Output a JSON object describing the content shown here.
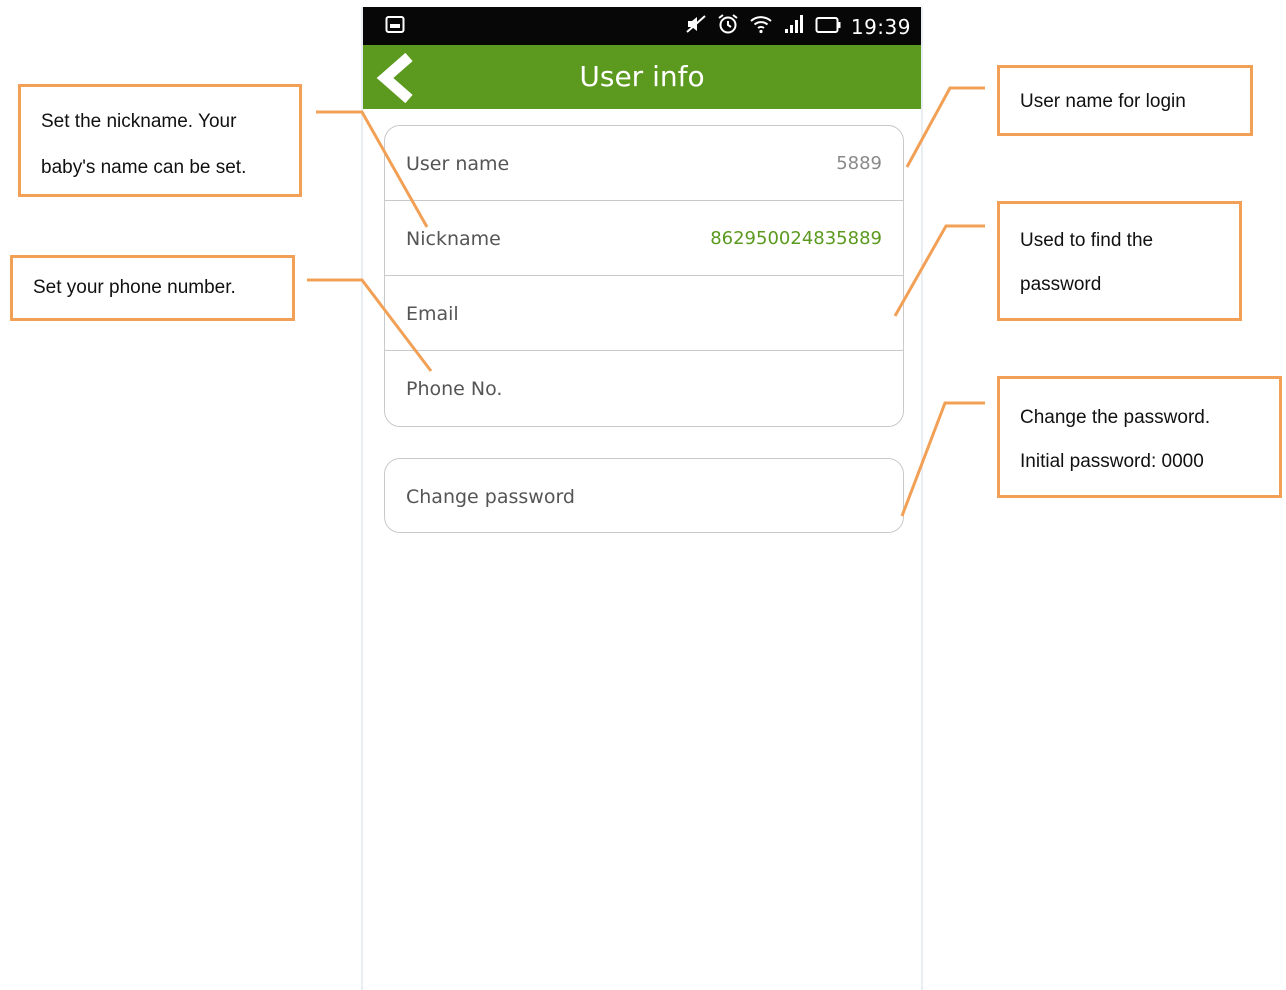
{
  "status_bar": {
    "time": "19:39",
    "left_icon": "image-notification-icon",
    "right_icons": [
      "mute-icon",
      "alarm-icon",
      "wifi-icon",
      "signal-icon",
      "battery-icon"
    ]
  },
  "app_bar": {
    "title": "User info",
    "back_icon": "back-chevron-icon",
    "color": "#5b9a1f"
  },
  "user_fields": [
    {
      "label": "User name",
      "value": "5889"
    },
    {
      "label": "Nickname",
      "value": "862950024835889"
    },
    {
      "label": "Email",
      "value": ""
    },
    {
      "label": "Phone No.",
      "value": ""
    }
  ],
  "change_password": {
    "label": "Change password"
  },
  "annotations": {
    "nickname_note": [
      "Set the nickname. Your",
      "baby's name can be set."
    ],
    "phone_note": [
      "Set your phone number."
    ],
    "username_note": [
      "User name for login"
    ],
    "email_note": [
      "Used to find the",
      "password"
    ],
    "password_note": [
      "Change the password.",
      "Initial password: 0000"
    ]
  },
  "colors": {
    "callout_border": "#f2a055",
    "accent_value": "#5b9a1f"
  }
}
